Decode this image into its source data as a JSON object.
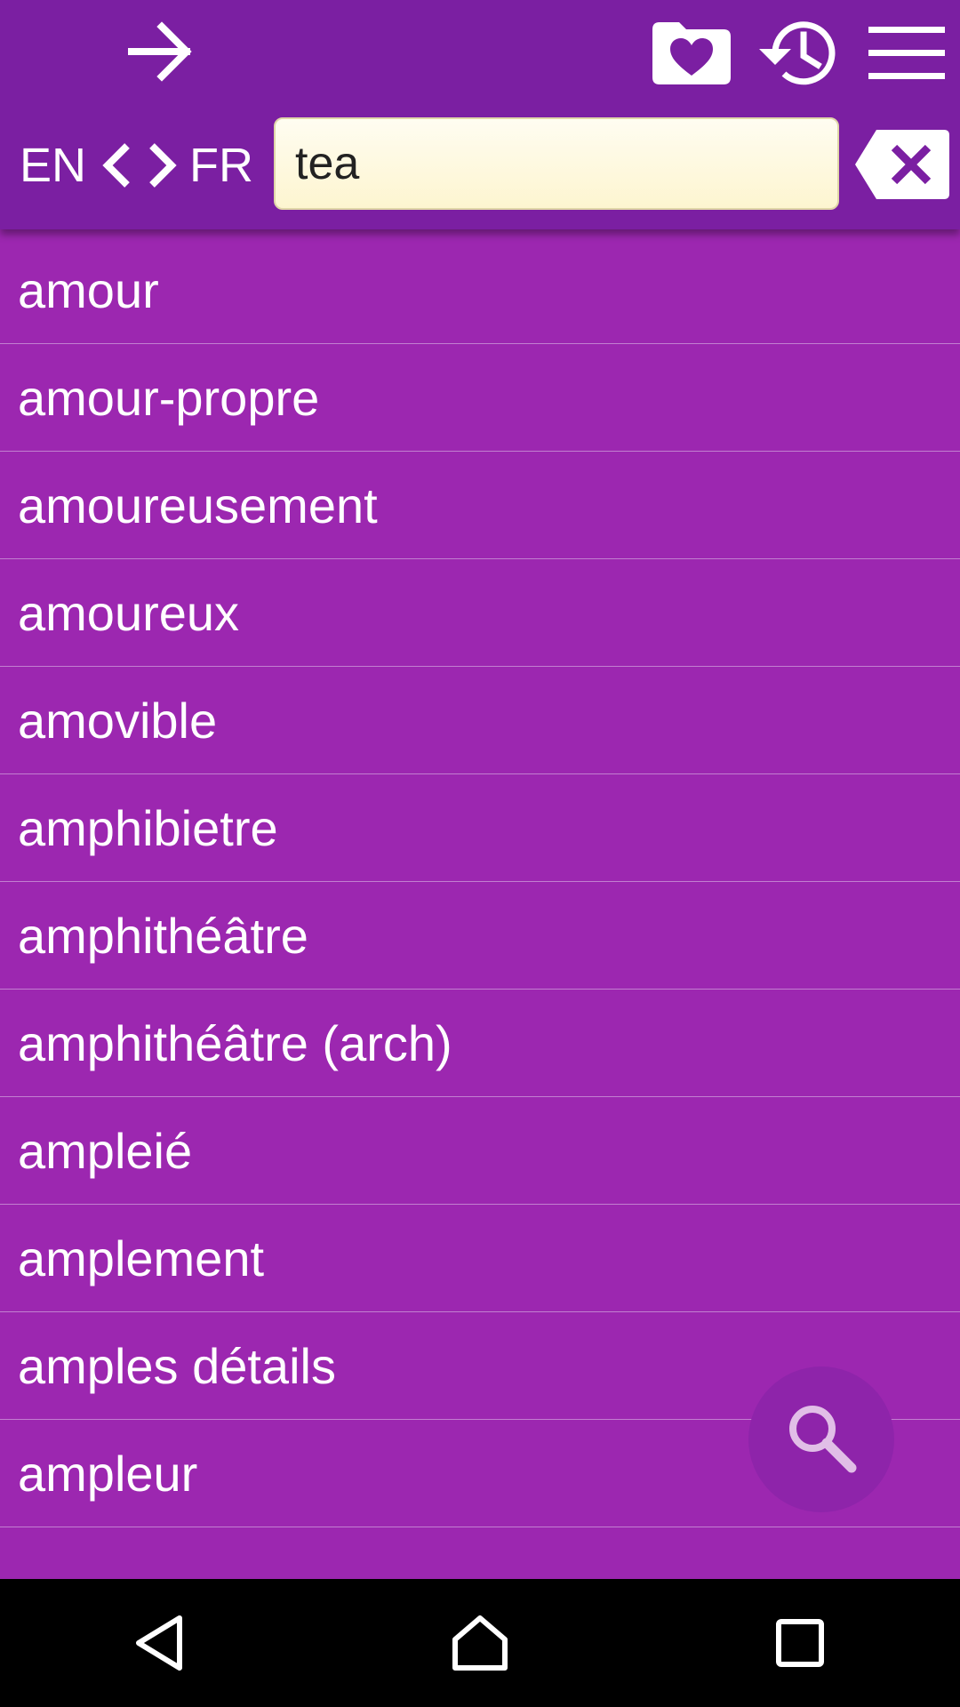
{
  "header": {
    "back_icon": "arrow-right-icon",
    "favorites_icon": "folder-heart-icon",
    "history_icon": "history-icon",
    "menu_icon": "hamburger-menu-icon"
  },
  "language": {
    "from": "EN",
    "to": "FR",
    "switch_icon": "chevron-left-right-icon"
  },
  "search": {
    "value": "tea",
    "clear_icon": "backspace-clear-icon"
  },
  "results": [
    "amour",
    "amour-propre",
    "amoureusement",
    "amoureux",
    "amovible",
    "amphibietre",
    "amphithéâtre",
    "amphithéâtre (arch)",
    "ampleié",
    "amplement",
    "amples détails",
    "ampleur"
  ],
  "fab": {
    "icon": "search-icon"
  },
  "navbar": {
    "back_icon": "nav-back-icon",
    "home_icon": "nav-home-icon",
    "recents_icon": "nav-recents-icon"
  },
  "colors": {
    "header_bg": "#7b1fa2",
    "list_bg": "#9c27b0",
    "divider": "#c27fd0",
    "search_bg": "#fdf5d0",
    "fab_bg": "#8e24aa",
    "navbar_bg": "#000000"
  }
}
